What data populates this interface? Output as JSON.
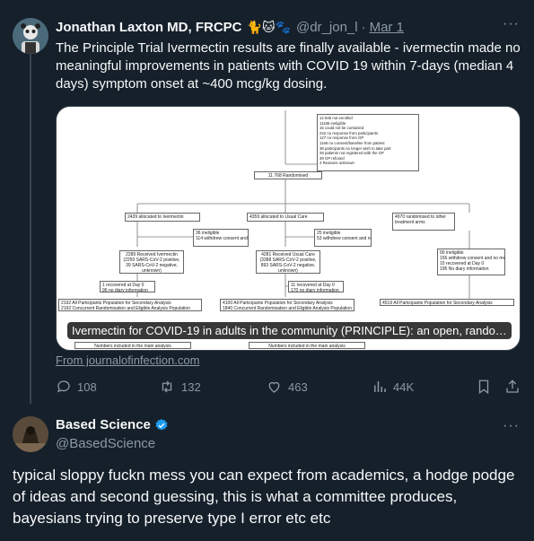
{
  "tweet1": {
    "name": "Jonathan Laxton MD, FRCPC",
    "emojis": "🐈🐱🐾",
    "handle": "@dr_jon_l",
    "separator": "·",
    "date": "Mar 1",
    "text": "The Principle Trial Ivermectin results are finally available - ivermectin made no meaningful improvements in patients with COVID 19 within 7-days (median 4 days) symptom onset at ~400 mcg/kg dosing.",
    "card": {
      "caption": "Ivermectin for COVID-19 in adults in the community (PRINCIPLE): an open, rando…",
      "source": "From journalofinfection.com",
      "flowchart": {
        "not_enrolled": "12 845 not enrolled\n11185 ineligible\n15 could not be contacted\n242 no response from participants\n127 no response from GP\n1166 no consent/baseline from patient\n38 participants no longer wish to take part\n29 patients not registered with the GP\n39 GP refused\n4 Reasons unknown",
        "randomised": "11 768 Randomised",
        "arm_ivermectin": "2439 allocated to Ivermectin",
        "arm_usual": "4359 allocated to Usual Care",
        "arm_other": "4970 randomised to other treatment arms",
        "ineligible_iv": "36 ineligible\n114 withdrew consent and no medical notes review",
        "ineligible_uc": "25 ineligible\n53 withdrew consent and no medical notes review",
        "received_iv": "2289 Received Ivermectin\n(2250 SARS-CoV-2 positive,\n39 SARS-CoV-2 negative,\nunknown)",
        "received_uc": "4281 Received Usual Care\n(3388 SARS-CoV-2 positive,\n893 SARS-CoV-2 negative,\nunknown)",
        "other_excluded": "90 ineligible\n156 withdrew consent and no medical notes review\n10 recovered at Day 0\n195 No diary information",
        "day0_iv": "1 recovered at Day 0\n96 no diary information",
        "day0_uc": "11 recovered at Day 0\n170 no diary information",
        "pop_iv": "2192 All Participants Population for Secondary Analysis\n2192 Concurrent Randomisation and Eligible Analysis Population",
        "pop_uc": "4100 All Participants Population for Secondary Analysis\n1840 Concurrent Randomisation and Eligible Analysis Population",
        "pop_other": "4519 All Participants Population for Secondary Analysis",
        "main_analysis_1": "Numbers included in the main analysis",
        "main_analysis_2": "Numbers included in the main analysis"
      }
    },
    "stats": {
      "replies": "108",
      "retweets": "132",
      "likes": "463",
      "views": "44K"
    }
  },
  "tweet2": {
    "name": "Based Science",
    "handle": "@BasedScience",
    "text": "typical sloppy fuckn mess you can expect from academics, a hodge podge of ideas and second guessing, this is what a committee produces, bayesians trying to preserve type I error etc etc"
  },
  "colors": {
    "background": "#15202b",
    "text": "#f7f9f9",
    "muted": "#8b98a5",
    "verified": "#1d9bf0"
  }
}
